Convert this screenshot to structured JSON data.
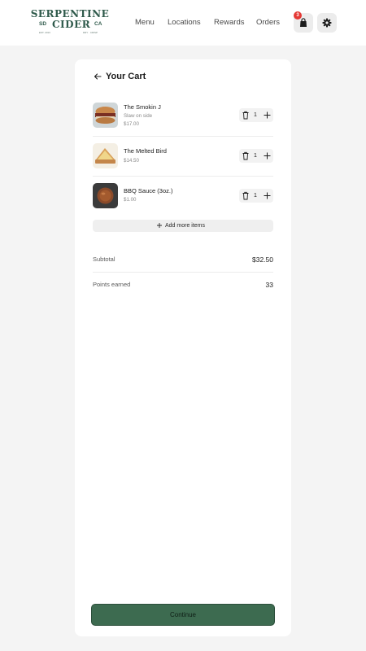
{
  "header": {
    "logo": {
      "line1": "SERPENTINE",
      "sd": "SD",
      "cider": "CIDER",
      "ca": "CA",
      "tiny_left": "EST. 2013",
      "tiny_right": "DRY · CRISP"
    },
    "nav": [
      "Menu",
      "Locations",
      "Rewards",
      "Orders"
    ],
    "cart_badge": "3",
    "icons": {
      "cart": "shopping-bag-icon",
      "settings": "gear-icon"
    }
  },
  "cart": {
    "title": "Your Cart",
    "items": [
      {
        "name": "The Smokin J",
        "note": "Slaw on side",
        "price": "$17.00",
        "qty": "1"
      },
      {
        "name": "The Melted Bird",
        "note": "",
        "price": "$14.50",
        "qty": "1"
      },
      {
        "name": "BBQ Sauce (3oz.)",
        "note": "",
        "price": "$1.00",
        "qty": "1"
      }
    ],
    "add_more": "Add more items",
    "subtotal_label": "Subtotal",
    "subtotal_value": "$32.50",
    "points_label": "Points earned",
    "points_value": "33",
    "continue_label": "Continue"
  },
  "colors": {
    "accent": "#3d6b50",
    "badge": "#e53935",
    "background": "#f4f4f4"
  }
}
